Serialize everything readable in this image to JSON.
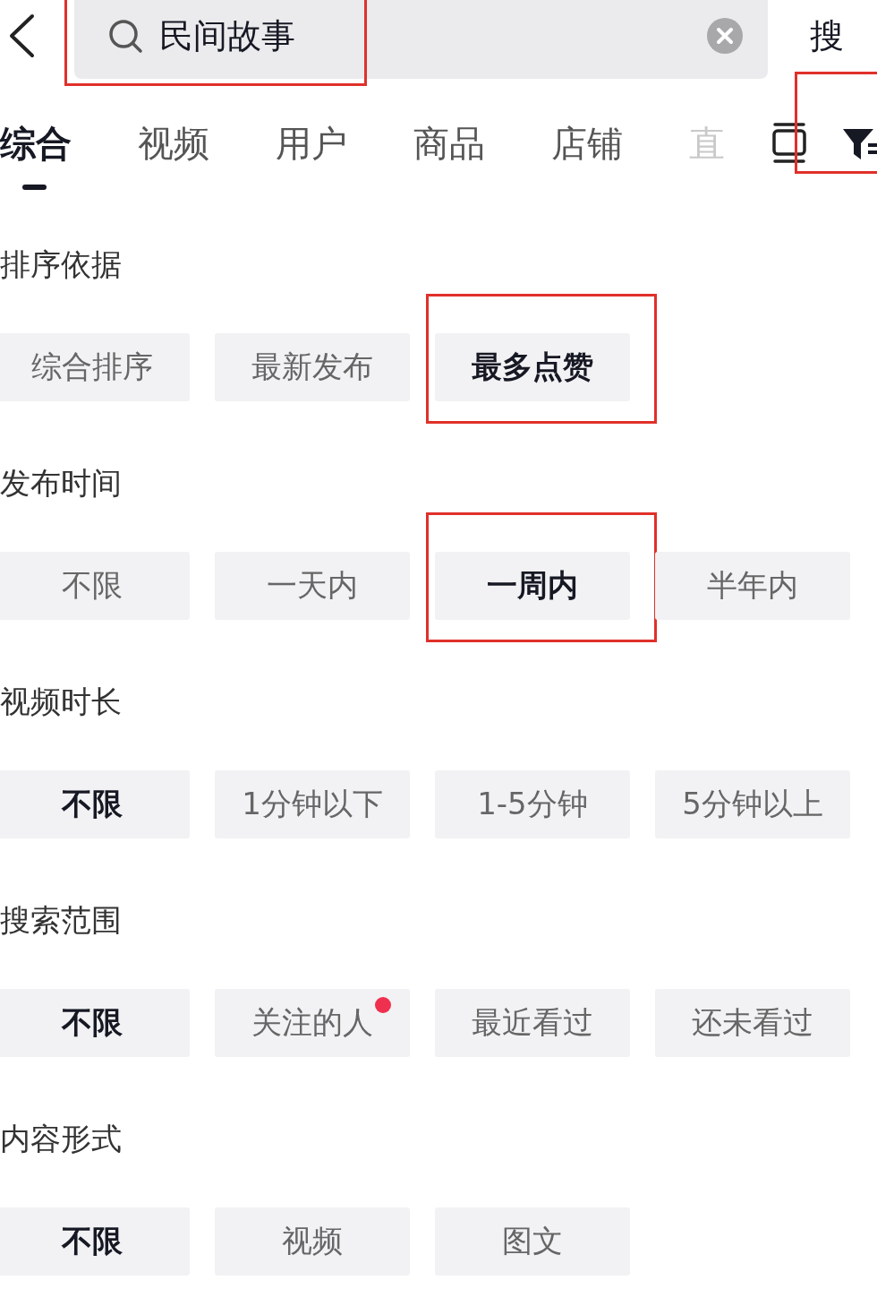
{
  "top_bar": {
    "search": {
      "value": "民间故事",
      "highlighted": true
    },
    "search_button": "搜"
  },
  "tabs": [
    {
      "label": "综合",
      "selected": true,
      "faded": false
    },
    {
      "label": "视频",
      "selected": false,
      "faded": false
    },
    {
      "label": "用户",
      "selected": false,
      "faded": false
    },
    {
      "label": "商品",
      "selected": false,
      "faded": false
    },
    {
      "label": "店铺",
      "selected": false,
      "faded": false
    },
    {
      "label": "直",
      "selected": false,
      "faded": true
    }
  ],
  "filter": {
    "highlighted": true
  },
  "sections": [
    {
      "title": "排序依据",
      "options": [
        {
          "label": "综合排序",
          "selected": false,
          "highlighted": false,
          "badge": false
        },
        {
          "label": "最新发布",
          "selected": false,
          "highlighted": false,
          "badge": false
        },
        {
          "label": "最多点赞",
          "selected": true,
          "highlighted": true,
          "badge": false
        }
      ]
    },
    {
      "title": "发布时间",
      "options": [
        {
          "label": "不限",
          "selected": false,
          "highlighted": false,
          "badge": false
        },
        {
          "label": "一天内",
          "selected": false,
          "highlighted": false,
          "badge": false
        },
        {
          "label": "一周内",
          "selected": true,
          "highlighted": true,
          "badge": false
        },
        {
          "label": "半年内",
          "selected": false,
          "highlighted": false,
          "badge": false
        }
      ]
    },
    {
      "title": "视频时长",
      "options": [
        {
          "label": "不限",
          "selected": true,
          "highlighted": false,
          "badge": false
        },
        {
          "label": "1分钟以下",
          "selected": false,
          "highlighted": false,
          "badge": false
        },
        {
          "label": "1-5分钟",
          "selected": false,
          "highlighted": false,
          "badge": false
        },
        {
          "label": "5分钟以上",
          "selected": false,
          "highlighted": false,
          "badge": false
        }
      ]
    },
    {
      "title": "搜索范围",
      "options": [
        {
          "label": "不限",
          "selected": true,
          "highlighted": false,
          "badge": false
        },
        {
          "label": "关注的人",
          "selected": false,
          "highlighted": false,
          "badge": true
        },
        {
          "label": "最近看过",
          "selected": false,
          "highlighted": false,
          "badge": false
        },
        {
          "label": "还未看过",
          "selected": false,
          "highlighted": false,
          "badge": false
        }
      ]
    },
    {
      "title": "内容形式",
      "options": [
        {
          "label": "不限",
          "selected": true,
          "highlighted": false,
          "badge": false
        },
        {
          "label": "视频",
          "selected": false,
          "highlighted": false,
          "badge": false
        },
        {
          "label": "图文",
          "selected": false,
          "highlighted": false,
          "badge": false
        }
      ]
    }
  ]
}
